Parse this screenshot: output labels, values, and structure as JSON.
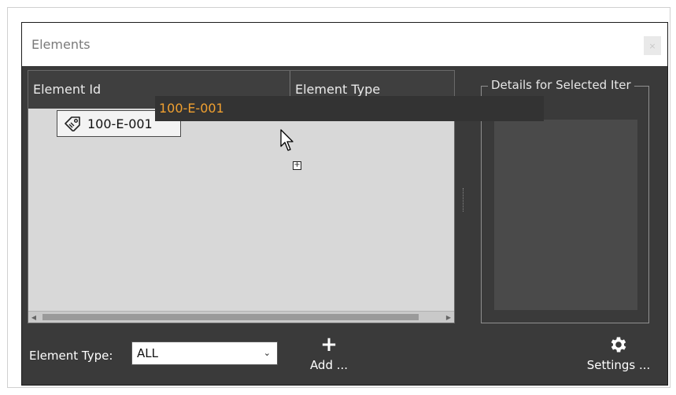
{
  "window": {
    "title": "Elements",
    "close_label": "×"
  },
  "grid": {
    "columns": [
      "Element Id",
      "Element Type"
    ],
    "rows": [
      {
        "element_id": "100-E-001"
      }
    ],
    "drag_ghost_text": "100-E-001"
  },
  "details": {
    "title": "Details for Selected Iter"
  },
  "footer": {
    "filter_label": "Element Type:",
    "filter_value": "ALL",
    "add_label": "Add ...",
    "settings_label": "Settings ..."
  },
  "colors": {
    "window_bg": "#3a3a3a",
    "grid_bg": "#d8d8d8",
    "drag_text": "#f0a030"
  },
  "icons": {
    "row_icon": "tag-icon",
    "add_icon": "plus-icon",
    "settings_icon": "gear-icon",
    "cursor": "drag-cursor-icon"
  }
}
